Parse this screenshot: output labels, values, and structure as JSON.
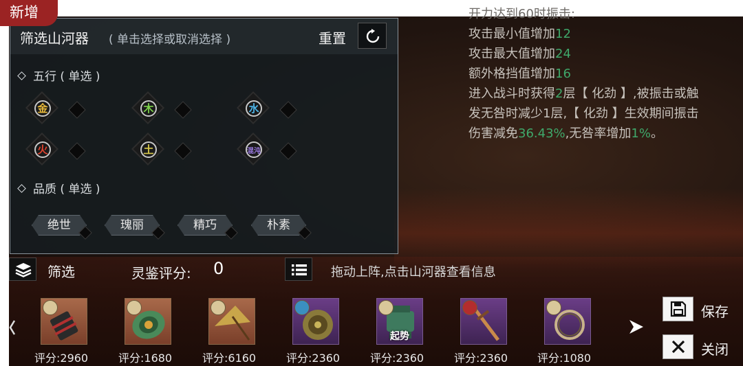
{
  "badge": {
    "label": "新增"
  },
  "filter_panel": {
    "title": "筛选山河器",
    "subtitle": "( 单击选择或取消选择 )",
    "reset_label": "重置",
    "elements_section": "五行 ( 单选 )",
    "elements": [
      {
        "char": "金",
        "color": "#e8b93a"
      },
      {
        "char": "木",
        "color": "#7cd04a"
      },
      {
        "char": "水",
        "color": "#4db3e6"
      },
      {
        "char": "火",
        "color": "#e0432e"
      },
      {
        "char": "土",
        "color": "#d8c84a"
      },
      {
        "char": "混沌",
        "color": "#9a7ae0"
      }
    ],
    "quality_section": "品质 ( 单选 )",
    "qualities": [
      "绝世",
      "瑰丽",
      "精巧",
      "朴素"
    ]
  },
  "info_text": {
    "line0": "开力达到60时振击:",
    "line1_prefix": "攻击最小值增加",
    "line1_val": "12",
    "line2_prefix": "攻击最大值增加",
    "line2_val": "24",
    "line3_prefix": "额外格挡值增加",
    "line3_val": "16",
    "line4_a": "进入战斗时获得",
    "line4_val": "2",
    "line4_b": "层【 化劲 】,被振击或触",
    "line5": "发无咎时减少1层,【 化劲 】生效期间振击",
    "line6_a": "伤害减免",
    "line6_val": "36.43%",
    "line6_b": ",无咎率增加",
    "line6_val2": "1%",
    "line6_c": "。",
    "highlight_color": "#3fa86a"
  },
  "bottom_bar": {
    "filter_label": "筛选",
    "score_label": "灵鉴评分:",
    "score_value": "0",
    "hint": "拖动上阵,点击山河器查看信息",
    "save_label": "保存",
    "close_label": "关闭"
  },
  "items": [
    {
      "score": "评分:2960",
      "rarity": "orange",
      "tag": "green-icon",
      "art": "scroll-bundle-icon",
      "state": ""
    },
    {
      "score": "评分:1680",
      "rarity": "orange",
      "tag": "green-icon",
      "art": "jade-disc-icon",
      "state": ""
    },
    {
      "score": "评分:6160",
      "rarity": "orange",
      "tag": "green-icon",
      "art": "umbrella-icon",
      "state": ""
    },
    {
      "score": "评分:2360",
      "rarity": "purple",
      "tag": "water-icon",
      "art": "bronze-disc-icon",
      "state": ""
    },
    {
      "score": "评分:2360",
      "rarity": "purple",
      "tag": "green-icon",
      "art": "bronze-cauldron-icon",
      "state": "起势"
    },
    {
      "score": "评分:2360",
      "rarity": "purple",
      "tag": "fire-icon",
      "art": "sword-icon",
      "state": ""
    },
    {
      "score": "评分:1080",
      "rarity": "purple",
      "tag": "green-icon",
      "art": "ring-icon",
      "state": ""
    }
  ]
}
